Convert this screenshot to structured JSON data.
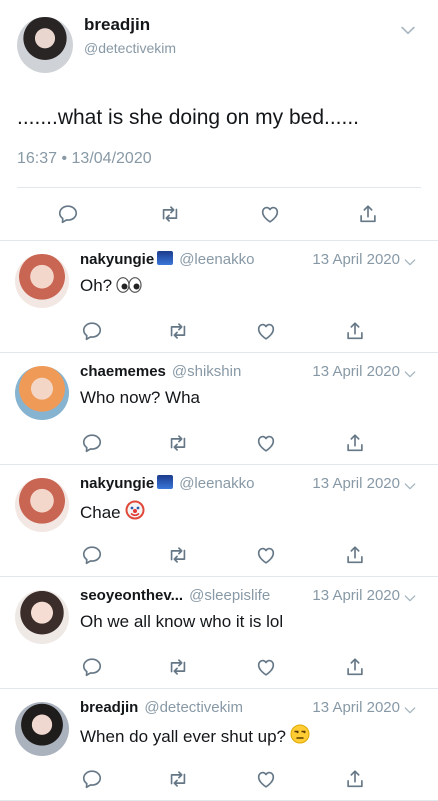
{
  "main_tweet": {
    "display_name": "breadjin",
    "handle": "@detectivekim",
    "text": ".......what is she doing on my bed......",
    "timestamp": "16:37 • 13/04/2020"
  },
  "replies": [
    {
      "display_name": "nakyungie",
      "handle": "@leenakko",
      "date": "13 April 2020",
      "text": "Oh?"
    },
    {
      "display_name": "chaememes",
      "handle": "@shikshin",
      "date": "13 April 2020",
      "text": "Who now? Wha"
    },
    {
      "display_name": "nakyungie",
      "handle": "@leenakko",
      "date": "13 April 2020",
      "text": "Chae"
    },
    {
      "display_name": "seoyeonthev...",
      "handle": "@sleepislife",
      "date": "13 April 2020",
      "text": "Oh we all know who it is lol"
    },
    {
      "display_name": "breadjin",
      "handle": "@detectivekim",
      "date": "13 April 2020",
      "text": "When do yall ever shut up?"
    }
  ],
  "icons": [
    "reply-icon",
    "retweet-icon",
    "like-icon",
    "share-icon",
    "chevron-down-icon",
    "eyes-emoji",
    "clown-emoji",
    "unamused-emoji",
    "flag-badge"
  ],
  "colors": {
    "text": "#14171a",
    "muted": "#8899a6",
    "icon": "#657786",
    "divider": "#e1e8ed"
  }
}
